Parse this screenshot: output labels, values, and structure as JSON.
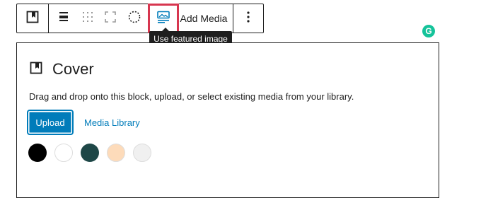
{
  "toolbar": {
    "add_media_label": "Add Media",
    "tooltip": "Use featured image"
  },
  "grammarly_letter": "G",
  "cover": {
    "title": "Cover",
    "instructions": "Drag and drop onto this block, upload, or select existing media from your library.",
    "upload_label": "Upload",
    "media_library_label": "Media Library",
    "swatch_colors": [
      "#000000",
      "#ffffff",
      "#1e4747",
      "#fddbba",
      "#f0f0f0"
    ]
  },
  "colors": {
    "accent": "#007cba",
    "highlight": "#d7364f",
    "tooltip_bg": "#1e1e1e"
  }
}
